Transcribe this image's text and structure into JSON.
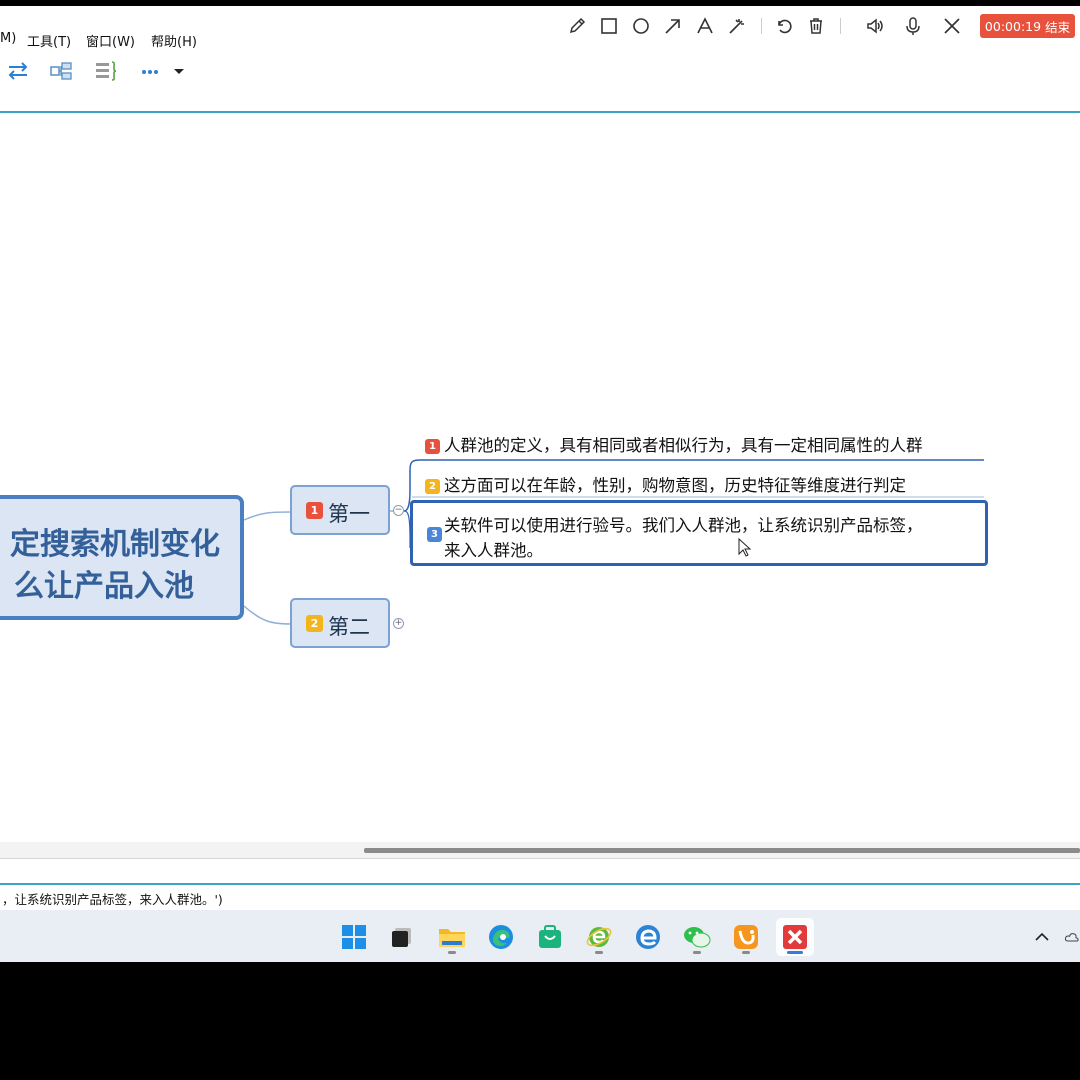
{
  "menu": {
    "items": [
      "M)",
      "工具(T)",
      "窗口(W)",
      "帮助(H)"
    ]
  },
  "toolbar": {
    "icons": [
      "swap-arrows-icon",
      "layout-icon",
      "outline-icon",
      "more-icon",
      "dropdown-arrow-icon"
    ]
  },
  "recorder": {
    "tools": [
      "pencil-icon",
      "rectangle-icon",
      "circle-icon",
      "arrow-icon",
      "text-icon",
      "magic-wand-icon",
      "undo-icon",
      "trash-icon",
      "speaker-icon",
      "microphone-icon",
      "close-icon"
    ],
    "timer": "00:00:19",
    "end_label": "结束"
  },
  "mindmap": {
    "central": {
      "line1": "定搜索机制变化",
      "line2": "么让产品入池"
    },
    "topics": [
      {
        "badge": "1",
        "label": "第一",
        "color": "#e8523d"
      },
      {
        "badge": "2",
        "label": "第二",
        "color": "#f3b51b"
      }
    ],
    "subtopics": [
      {
        "badge": "1",
        "text": "人群池的定义，具有相同或者相似行为，具有一定相同属性的人群",
        "color": "#e8523d"
      },
      {
        "badge": "2",
        "text": "这方面可以在年龄，性别，购物意图，历史特征等维度进行判定",
        "color": "#f3b51b"
      },
      {
        "badge": "3",
        "line1": "关软件可以使用进行验号。我们入人群池，让系统识别产品标签，",
        "line2": "来入人群池。",
        "color": "#4a86d8"
      }
    ]
  },
  "status": {
    "text": "，让系统识别产品标签，来入人群池。')"
  },
  "taskbar": {
    "apps": [
      "windows-start-icon",
      "task-view-icon",
      "file-explorer-icon",
      "edge-icon",
      "store-icon",
      "ie-browser-icon",
      "edge-legacy-icon",
      "wechat-icon",
      "uc-browser-icon",
      "xmind-icon"
    ],
    "tray": [
      "chevron-up-icon",
      "cloud-icon"
    ]
  }
}
